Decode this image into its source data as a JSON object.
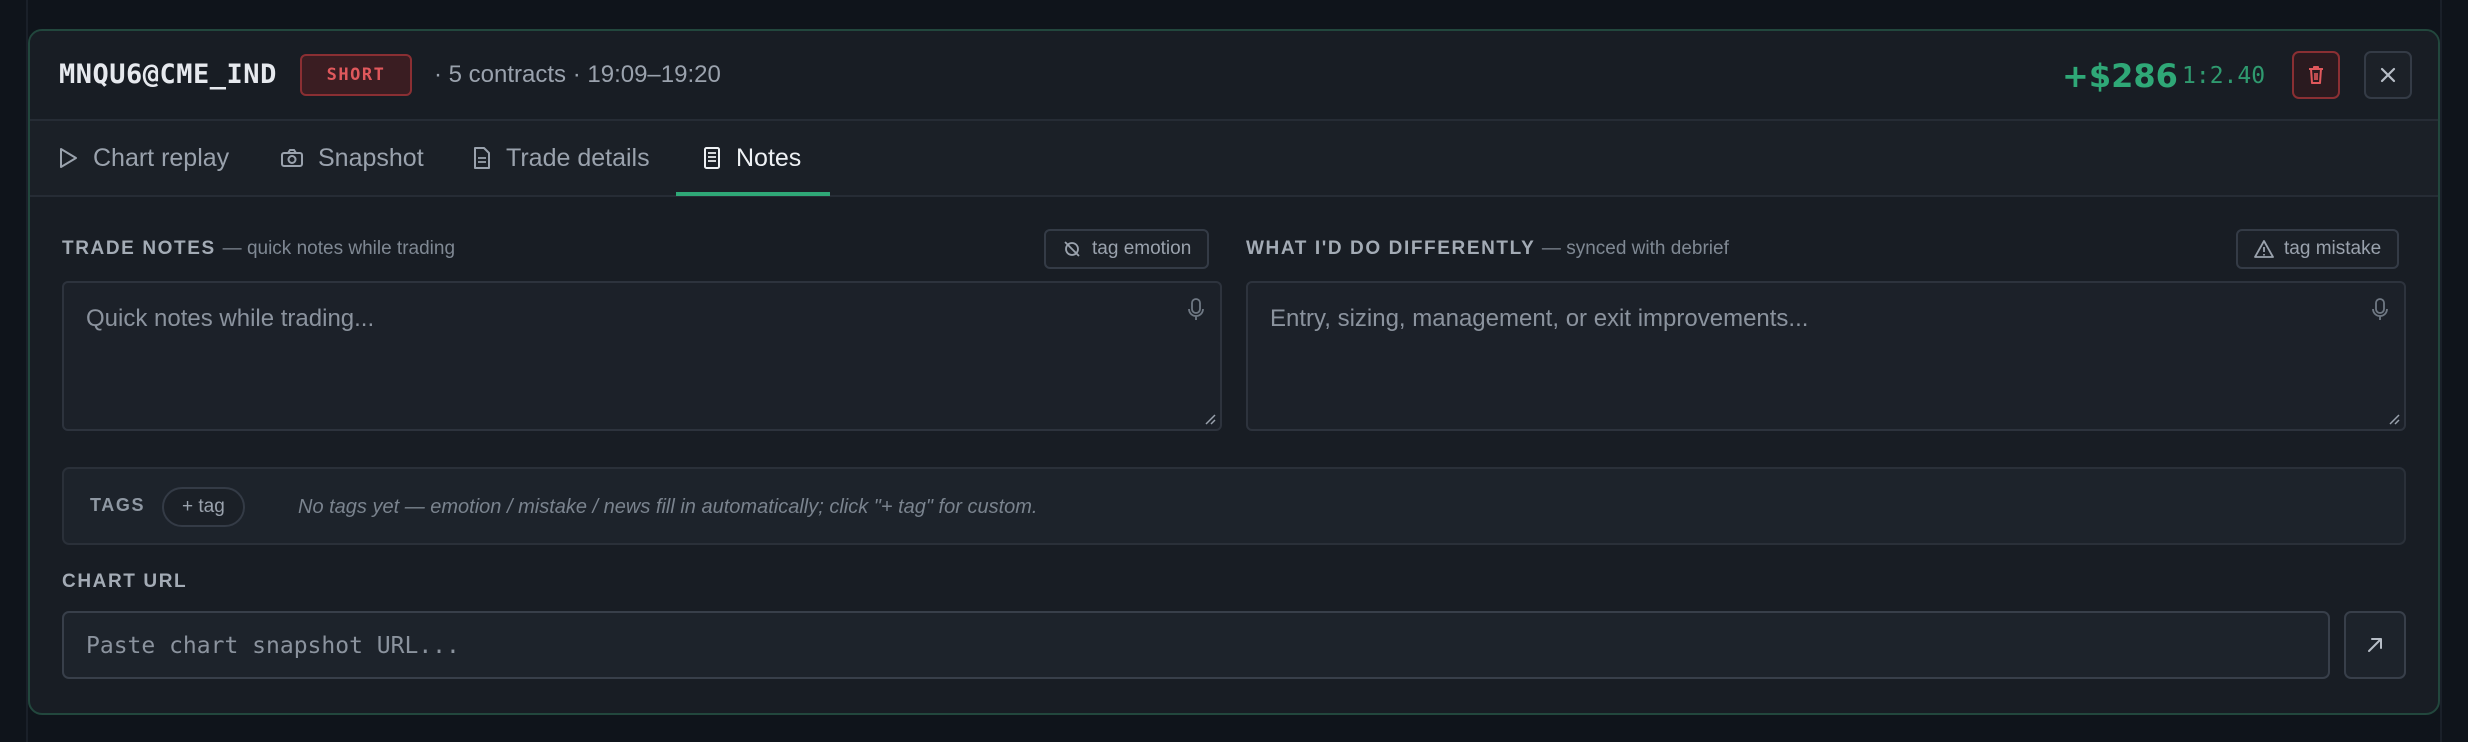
{
  "header": {
    "symbol": "MNQU6@CME_IND",
    "side": "SHORT",
    "meta": "· 5 contracts · 19:09–19:20",
    "pnl": "+$286",
    "risk_reward": "1:2.40",
    "delete_icon": "trash-icon",
    "close_icon": "close-icon"
  },
  "tabs": [
    {
      "label": "Chart replay",
      "icon": "play-icon",
      "active": false
    },
    {
      "label": "Snapshot",
      "icon": "camera-icon",
      "active": false
    },
    {
      "label": "Trade details",
      "icon": "document-icon",
      "active": false
    },
    {
      "label": "Notes",
      "icon": "notes-icon",
      "active": true
    }
  ],
  "trade_notes": {
    "label": "TRADE NOTES",
    "sublabel": "— quick notes while trading",
    "tag_button": "tag emotion",
    "placeholder": "Quick notes while trading..."
  },
  "differently": {
    "label": "WHAT I'D DO DIFFERENTLY",
    "sublabel": "— synced with debrief",
    "tag_button": "tag mistake",
    "placeholder": "Entry, sizing, management, or exit improvements..."
  },
  "tags": {
    "label": "TAGS",
    "add_label": "+ tag",
    "empty_text": "No tags yet — emotion / mistake / news fill in automatically; click \"+ tag\" for custom."
  },
  "chart_url": {
    "label": "CHART URL",
    "placeholder": "Paste chart snapshot URL...",
    "open_icon": "arrow-up-right-icon"
  },
  "colors": {
    "accent": "#2fa877",
    "short": "#e0585c",
    "border_accent": "#22473d"
  }
}
